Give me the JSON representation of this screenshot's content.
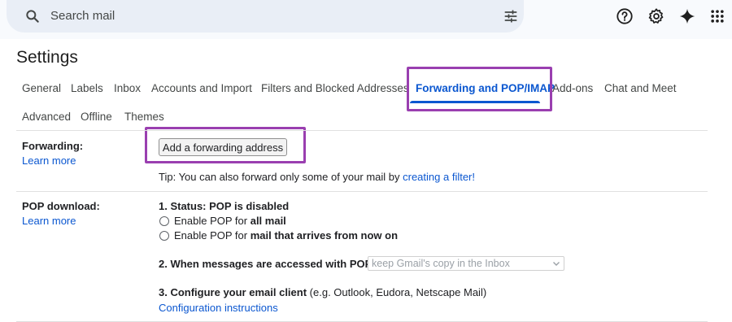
{
  "search": {
    "placeholder": "Search mail"
  },
  "icons": {
    "search": "search-icon",
    "tune": "tune-icon",
    "help": "help-icon",
    "settings": "gear-icon",
    "gemini": "gemini-sparkle-icon",
    "apps": "apps-grid-icon"
  },
  "page": {
    "title": "Settings"
  },
  "tabs": [
    {
      "label": "General"
    },
    {
      "label": "Labels"
    },
    {
      "label": "Inbox"
    },
    {
      "label": "Accounts and Import"
    },
    {
      "label": "Filters and Blocked Addresses"
    },
    {
      "label": "Forwarding and POP/IMAP",
      "active": true
    },
    {
      "label": "Add-ons"
    },
    {
      "label": "Chat and Meet"
    },
    {
      "label": "Advanced"
    },
    {
      "label": "Offline"
    },
    {
      "label": "Themes"
    }
  ],
  "forwarding": {
    "label": "Forwarding:",
    "learn_more": "Learn more",
    "button": "Add a forwarding address",
    "tip_prefix": "Tip: You can also forward only some of your mail by",
    "tip_link": "creating a filter!"
  },
  "pop": {
    "label": "POP download:",
    "learn_more": "Learn more",
    "status": "1. Status: POP is disabled",
    "opt1_prefix": "Enable POP for",
    "opt1_bold": "all mail",
    "opt2_prefix": "Enable POP for",
    "opt2_bold": "mail that arrives from now on",
    "step2": "2. When messages are accessed with POP",
    "step2_select": "keep Gmail's copy in the Inbox",
    "step3": "3. Configure your email client",
    "step3_note": "(e.g. Outlook, Eudora, Netscape Mail)",
    "config_link": "Configuration instructions"
  },
  "colors": {
    "accent": "#0b57d0",
    "highlight": "#9a3fb0"
  }
}
